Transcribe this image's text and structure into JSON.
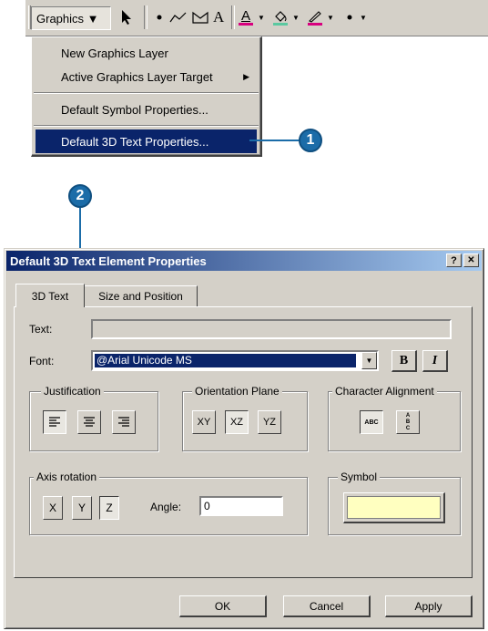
{
  "toolbar": {
    "graphics_label": "Graphics ▼",
    "text_tool_glyph": "A",
    "font_color_glyph": "A",
    "fill_glyph": "♪"
  },
  "menu": {
    "items": [
      {
        "label": "New Graphics Layer"
      },
      {
        "label": "Active Graphics Layer Target"
      },
      {
        "label": "Default Symbol Properties..."
      },
      {
        "label": "Default 3D Text Properties..."
      }
    ],
    "submenu_arrow": "▶"
  },
  "callouts": {
    "one": "1",
    "two": "2"
  },
  "dialog": {
    "title": "Default 3D Text Element Properties",
    "help_btn": "?",
    "close_btn": "✕",
    "tabs": [
      {
        "label": "3D Text"
      },
      {
        "label": "Size and Position"
      }
    ],
    "text_label": "Text:",
    "text_value": "",
    "font_label": "Font:",
    "font_value": "@Arial Unicode MS",
    "bold": "B",
    "italic": "I",
    "justification": {
      "label": "Justification"
    },
    "orientation": {
      "label": "Orientation Plane",
      "buttons": [
        "XY",
        "XZ",
        "YZ"
      ]
    },
    "char_align": {
      "label": "Character Alignment",
      "h": "ABC",
      "v": "A\nB\nC"
    },
    "axis": {
      "label": "Axis rotation",
      "buttons": [
        "X",
        "Y",
        "Z"
      ],
      "angle_label": "Angle:",
      "angle_value": "0"
    },
    "symbol": {
      "label": "Symbol",
      "color": "#ffffc0"
    },
    "ok": "OK",
    "cancel": "Cancel",
    "apply": "Apply"
  }
}
